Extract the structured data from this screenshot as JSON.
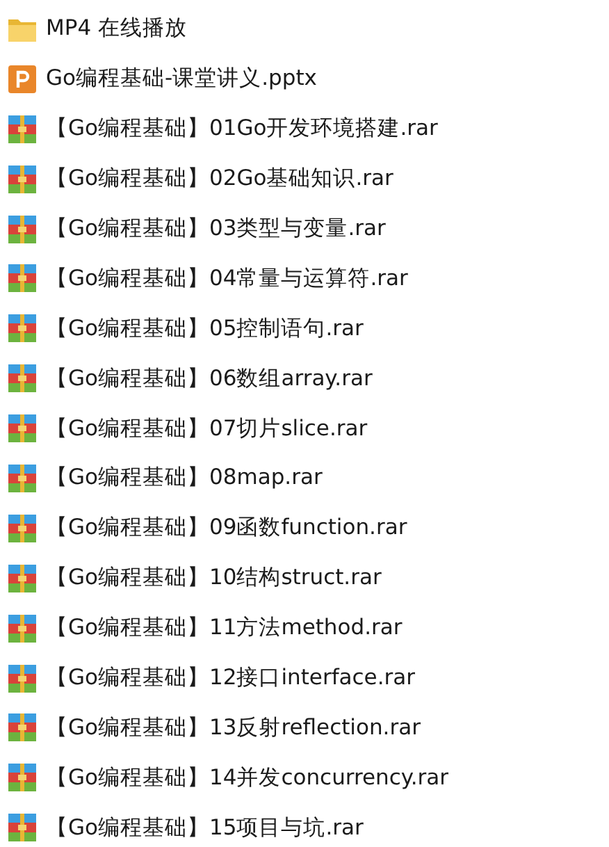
{
  "files": [
    {
      "kind": "folder",
      "name": "MP4 在线播放"
    },
    {
      "kind": "pptx",
      "name": "Go编程基础-课堂讲义.pptx"
    },
    {
      "kind": "rar",
      "name": "【Go编程基础】01Go开发环境搭建.rar"
    },
    {
      "kind": "rar",
      "name": "【Go编程基础】02Go基础知识.rar"
    },
    {
      "kind": "rar",
      "name": "【Go编程基础】03类型与变量.rar"
    },
    {
      "kind": "rar",
      "name": "【Go编程基础】04常量与运算符.rar"
    },
    {
      "kind": "rar",
      "name": "【Go编程基础】05控制语句.rar"
    },
    {
      "kind": "rar",
      "name": "【Go编程基础】06数组array.rar"
    },
    {
      "kind": "rar",
      "name": "【Go编程基础】07切片slice.rar"
    },
    {
      "kind": "rar",
      "name": "【Go编程基础】08map.rar"
    },
    {
      "kind": "rar",
      "name": "【Go编程基础】09函数function.rar"
    },
    {
      "kind": "rar",
      "name": "【Go编程基础】10结构struct.rar"
    },
    {
      "kind": "rar",
      "name": "【Go编程基础】11方法method.rar"
    },
    {
      "kind": "rar",
      "name": "【Go编程基础】12接口interface.rar"
    },
    {
      "kind": "rar",
      "name": "【Go编程基础】13反射reflection.rar"
    },
    {
      "kind": "rar",
      "name": "【Go编程基础】14并发concurrency.rar"
    },
    {
      "kind": "rar",
      "name": "【Go编程基础】15项目与坑.rar"
    }
  ]
}
